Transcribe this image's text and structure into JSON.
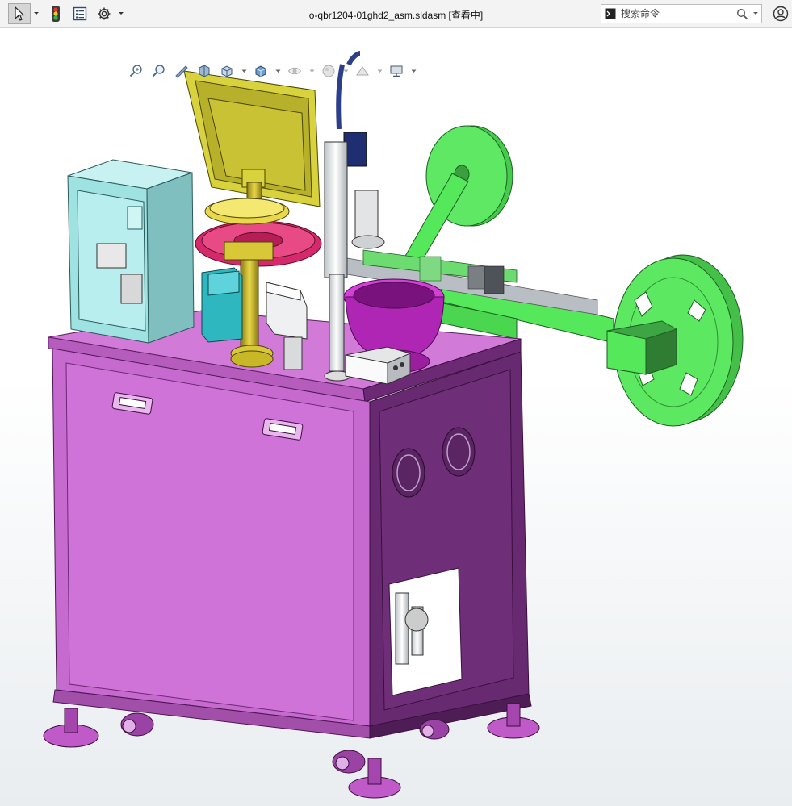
{
  "window": {
    "document_title": "o-qbr1204-01ghd2_asm.sldasm [查看中]"
  },
  "search": {
    "placeholder": "搜索命令"
  },
  "icons": {
    "select": "select-arrow-icon",
    "traffic_light": "traffic-light-icon",
    "feature_tree": "feature-tree-icon",
    "options": "gear-icon",
    "command": "command-prompt-icon",
    "search": "search-icon",
    "user": "user-icon"
  },
  "heads_up_toolbar": {
    "tools": [
      "zoom-to-fit-icon",
      "zoom-to-area-icon",
      "previous-view-icon",
      "section-view-icon",
      "view-orientation-icon",
      "display-style-icon",
      "hide-show-icon",
      "edit-appearance-icon",
      "apply-scene-icon",
      "view-settings-icon"
    ]
  },
  "colors": {
    "frame_top": "#d27ad8",
    "frame_front": "#c76ad0",
    "frame_side": "#6b2a73",
    "green": "#55e85a",
    "cabinet": "#a6e8e8",
    "monitor": "#d8d23c",
    "ring": "#d42a6b",
    "bowl": "#b026b4"
  }
}
